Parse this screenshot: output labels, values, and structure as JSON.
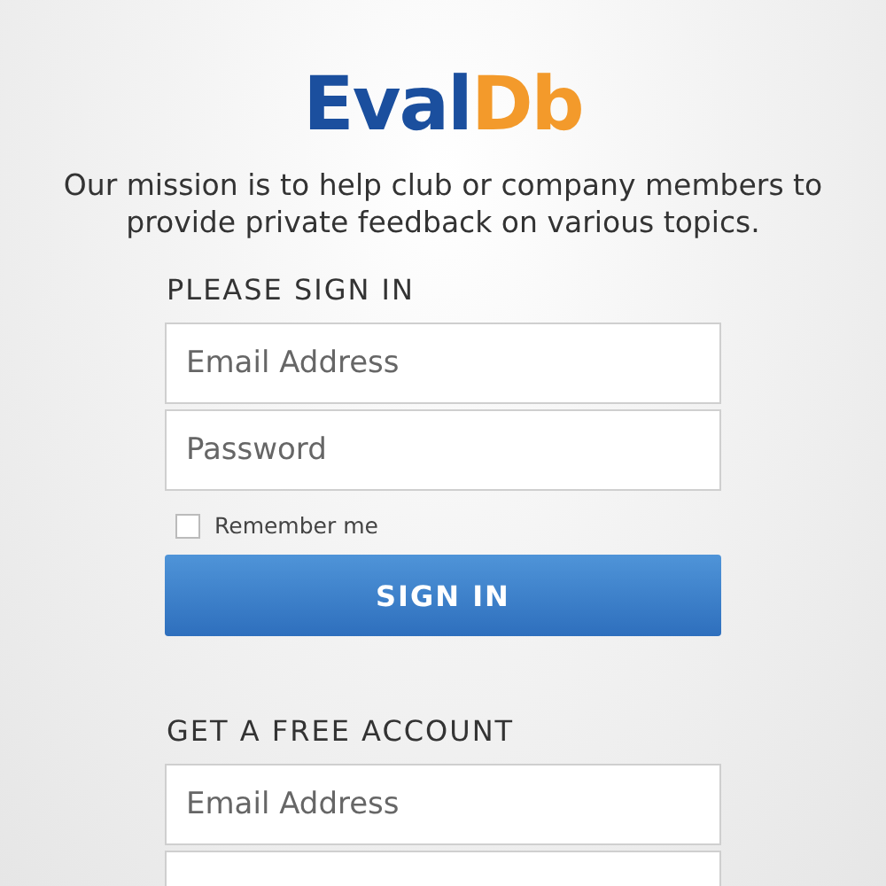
{
  "logo": {
    "primary": "Eval",
    "accent": "Db"
  },
  "mission": "Our mission is to help club or company members to provide private feedback on various topics.",
  "sign_in": {
    "heading": "PLEASE SIGN IN",
    "fields": [
      {
        "placeholder": "Email Address"
      },
      {
        "placeholder": "Password"
      }
    ],
    "remember": {
      "label": "Remember me",
      "checked": false
    },
    "button": "SIGN IN"
  },
  "register": {
    "heading": "GET A FREE ACCOUNT",
    "fields": [
      {
        "kind": "full",
        "placeholder": "Email Address"
      },
      {
        "kind": "cut"
      }
    ]
  }
}
